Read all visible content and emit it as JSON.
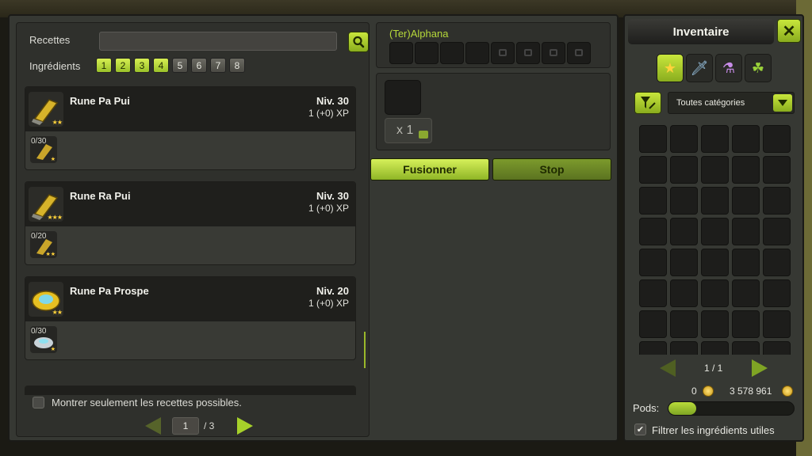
{
  "recipes_panel": {
    "search_label": "Recettes",
    "search_value": "",
    "ingredients_label": "Ingrédients",
    "ingredient_filters": [
      {
        "label": "1",
        "active": true
      },
      {
        "label": "2",
        "active": true
      },
      {
        "label": "3",
        "active": true
      },
      {
        "label": "4",
        "active": true
      },
      {
        "label": "5",
        "active": false
      },
      {
        "label": "6",
        "active": false
      },
      {
        "label": "7",
        "active": false
      },
      {
        "label": "8",
        "active": false
      }
    ],
    "recipes": [
      {
        "name": "Rune Pa Pui",
        "level": "Niv. 30",
        "xp": "1 (+0) XP",
        "ingredient_count": "0/30",
        "icon": "rune-pa-pui-icon"
      },
      {
        "name": "Rune Ra Pui",
        "level": "Niv. 30",
        "xp": "1 (+0) XP",
        "ingredient_count": "0/20",
        "icon": "rune-ra-pui-icon"
      },
      {
        "name": "Rune Pa Prospe",
        "level": "Niv. 20",
        "xp": "1 (+0) XP",
        "ingredient_count": "0/30",
        "icon": "rune-pa-prospe-icon"
      }
    ],
    "show_possible_label": "Montrer seulement les recettes possibles.",
    "show_possible_checked": false,
    "page_current": "1",
    "page_total": "/ 3"
  },
  "craft_panel": {
    "target_name": "(Ter)Alphana",
    "quantity": "x 1",
    "fuse_label": "Fusionner",
    "stop_label": "Stop"
  },
  "inventory": {
    "title": "Inventaire",
    "close_label": "✕",
    "tabs": [
      {
        "icon": "star-icon",
        "glyph": "★",
        "active": true
      },
      {
        "icon": "sword-icon",
        "glyph": "🗡",
        "active": false
      },
      {
        "icon": "potion-icon",
        "glyph": "⚗",
        "active": false
      },
      {
        "icon": "leaf-icon",
        "glyph": "☘",
        "active": false
      }
    ],
    "category_label": "Toutes catégories",
    "page": "1   / 1",
    "kamas_left": "0",
    "kamas_right": "3 578 961",
    "pods_label": "Pods:",
    "pods_fill_fraction": 0.22,
    "filter_useful_label": "Filtrer les ingrédients utiles",
    "filter_useful_checked": true
  },
  "colors": {
    "accent_green": "#a6d12a",
    "panel_bg": "#363833",
    "slot_bg": "#1d1d1b"
  }
}
